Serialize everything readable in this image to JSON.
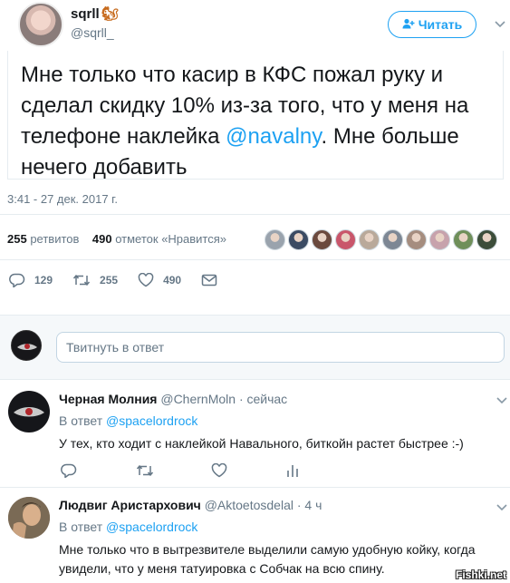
{
  "tweet": {
    "author_name": "sqrll",
    "author_handle": "@sqrll_",
    "follow_label": "Читать",
    "text_before": "Мне только что касир в КФС пожал руку и сделал скидку 10% из-за того, что у меня на телефоне наклейка ",
    "mention": "@navalny",
    "text_after": ". Мне больше нечего добавить",
    "timestamp": "3:41 - 27 дек. 2017 г."
  },
  "stats": {
    "retweets_count": "255",
    "retweets_label": "ретвитов",
    "likes_count": "490",
    "likes_label": "отметок «Нравится»",
    "liker_colors": [
      "#9aa3ad",
      "#3b4b63",
      "#6b4a3e",
      "#c9566b",
      "#b9a99a",
      "#7d8794",
      "#a58d7f",
      "#c7a2ac",
      "#6f8f5a",
      "#3c4d3a"
    ]
  },
  "actions": {
    "replies": "129",
    "retweets": "255",
    "likes": "490"
  },
  "compose": {
    "placeholder": "Твитнуть в ответ"
  },
  "replies": [
    {
      "name": "Черная Молния",
      "handle": "@ChernMoln",
      "time": "· сейчас",
      "reply_to_label": "В ответ",
      "reply_to": "@spacelordrock",
      "text": "У тех, кто ходит с наклейкой Навального, биткойн растет быстрее :-)"
    },
    {
      "name": "Людвиг Аристархович",
      "handle": "@Aktoetosdelal",
      "time": "· 4 ч",
      "reply_to_label": "В ответ",
      "reply_to": "@spacelordrock",
      "text": "Мне только что в вытрезвителе выделили самую удобную койку, когда увидели, что у меня татуировка с Собчак на всю спину."
    }
  ],
  "watermark": "Fishki.net",
  "colors": {
    "accent": "#1da1f2",
    "secondary_text": "#657786",
    "divider": "#e6ecf0"
  }
}
